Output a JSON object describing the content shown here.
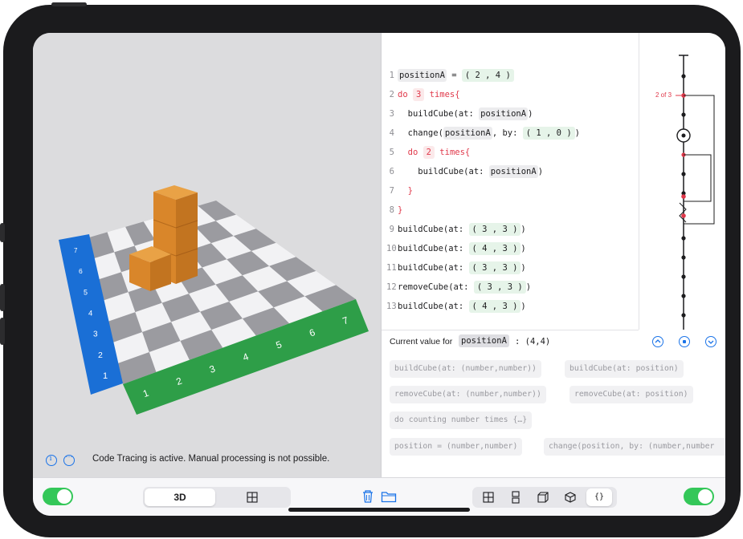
{
  "code": {
    "lines": [
      {
        "num": "1",
        "text": "positionA = ( 2 , 4 )"
      },
      {
        "num": "2",
        "text": "do 3 times{"
      },
      {
        "num": "3",
        "text": "buildCube(at: positionA)"
      },
      {
        "num": "4",
        "text": "change(positionA, by: ( 1 , 0 ))"
      },
      {
        "num": "5",
        "text": "do 2 times{"
      },
      {
        "num": "6",
        "text": "buildCube(at: positionA)"
      },
      {
        "num": "7",
        "text": "}"
      },
      {
        "num": "8",
        "text": "}"
      },
      {
        "num": "9",
        "text": "buildCube(at: ( 3 , 3 ))"
      },
      {
        "num": "10",
        "text": "buildCube(at: ( 4 , 3 ))"
      },
      {
        "num": "11",
        "text": "buildCube(at: ( 3 , 3 ))"
      },
      {
        "num": "12",
        "text": "removeCube(at: ( 3 , 3 ))"
      },
      {
        "num": "13",
        "text": "buildCube(at: ( 4 , 3 ))"
      }
    ]
  },
  "trace": {
    "iteration_label": "2 of 3"
  },
  "current_value": {
    "prefix": "Current value for",
    "variable": "positionA",
    "value": ": (4,4)"
  },
  "palette": [
    "buildCube(at: (number,number))",
    "buildCube(at: position)",
    "removeCube(at: (number,number))",
    "removeCube(at: position)",
    "do counting number times {…}",
    "position = (number,number)",
    "change(position, by: (number,number"
  ],
  "status_text": "Code Tracing is active. Manual processing is not possible.",
  "grid": {
    "x_labels": [
      "1",
      "2",
      "3",
      "4",
      "5",
      "6",
      "7"
    ],
    "y_labels": [
      "1",
      "2",
      "3",
      "4",
      "5",
      "6",
      "7"
    ]
  },
  "toolbar": {
    "view_3d_label": "3D",
    "braces_label": "{}"
  },
  "colors": {
    "accent": "#1a73e8",
    "toggle_on": "#34c759",
    "axis_blue": "#1a6fd6",
    "axis_green": "#2e9e48",
    "cube": "#d9862a",
    "keyword_red": "#e0384a"
  },
  "icons": [
    "info-icon",
    "ellipsis-icon",
    "trash-icon",
    "folder-icon",
    "grid-icon",
    "split-icon",
    "cube-outline-icon",
    "cube-icon",
    "chevron-up-icon",
    "stop-icon",
    "chevron-down-icon"
  ]
}
